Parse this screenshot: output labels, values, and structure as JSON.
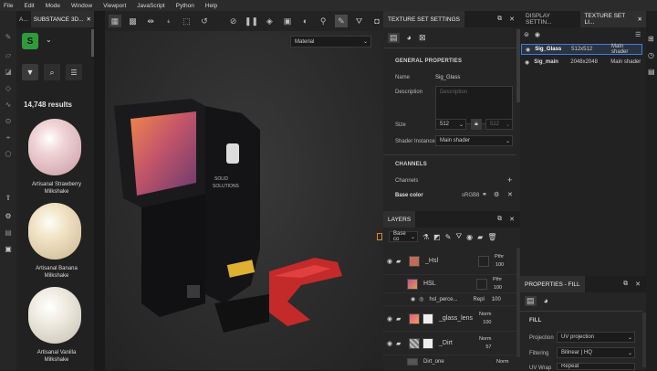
{
  "menu": [
    "File",
    "Edit",
    "Mode",
    "Window",
    "Viewport",
    "JavaScript",
    "Python",
    "Help"
  ],
  "assets": {
    "tab_short": "A...",
    "tab_title": "SUBSTANCE 3D...",
    "results": "14,748 results",
    "items": [
      {
        "name": "Artisanal Strawberry Milkshake",
        "color": "#e9c4c6"
      },
      {
        "name": "Artisanal Banana Milkshake",
        "color": "#efe2c6"
      },
      {
        "name": "Artisanal Vanilla Milkshake",
        "color": "#eeebe2"
      }
    ]
  },
  "viewport": {
    "material_select": "Material"
  },
  "texture_settings": {
    "tab_title": "TEXTURE SET SETTINGS",
    "general_header": "GENERAL PROPERTIES",
    "name_label": "Name",
    "name_value": "Sig_Glass",
    "description_label": "Description",
    "description_placeholder": "Description",
    "size_label": "Size",
    "size_value": "512",
    "size_value2": "512",
    "shader_label": "Shader Instance",
    "shader_value": "Main shader",
    "channels_header": "CHANNELS",
    "channels_label": "Channels",
    "base_color_label": "Base color",
    "base_color_space": "sRGB8"
  },
  "layers": {
    "tab_title": "LAYERS",
    "channel_select": "Base co",
    "rows": [
      {
        "name": "_Hsl",
        "blend": "Pthr",
        "opacity": "100"
      },
      {
        "name": "HSL",
        "blend": "Pthr",
        "opacity": "100"
      },
      {
        "name": "hsl_perce...",
        "blend": "Repl",
        "opacity": "100"
      },
      {
        "name": "_glass_lens",
        "blend": "Norm",
        "opacity": "100"
      },
      {
        "name": "_Dirt",
        "blend": "Norm",
        "opacity": "57"
      },
      {
        "name": "Dirt_one",
        "blend": "Norm",
        "opacity": ""
      }
    ]
  },
  "texture_list": {
    "tab_display": "DISPLAY SETTIN...",
    "tab_list": "TEXTURE SET LI...",
    "rows": [
      {
        "name": "Sig_Glass",
        "size": "512x512",
        "shader": "Main shader"
      },
      {
        "name": "Sig_main",
        "size": "2048x2048",
        "shader": "Main shader"
      }
    ]
  },
  "properties": {
    "tab_title": "PROPERTIES - FILL",
    "fill_header": "FILL",
    "projection_label": "Projection",
    "projection_value": "UV projection",
    "filtering_label": "Filtering",
    "filtering_value": "Bilinear | HQ",
    "uvwrap_label": "UV Wrap",
    "uvwrap_value": "Repeat"
  },
  "colors": {
    "accent": "#3d7de0",
    "substance_green": "#4cd964",
    "highlight": "#e0a040"
  }
}
